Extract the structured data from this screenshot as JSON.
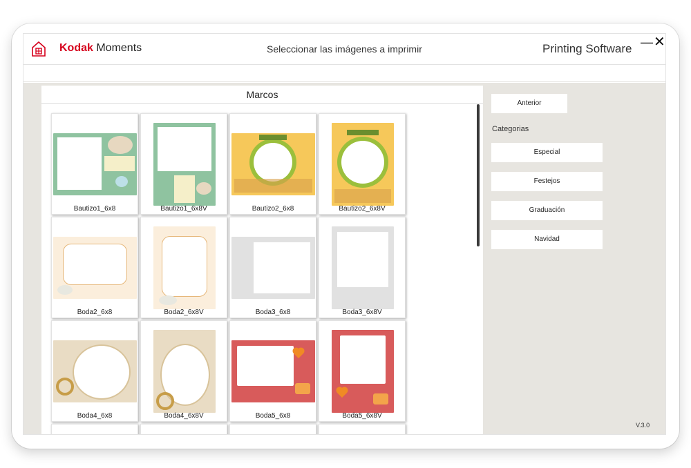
{
  "window": {
    "brand_kodak": "Kodak",
    "brand_moments": " Moments",
    "subtitle": "Seleccionar las imágenes a imprimir",
    "app_name": "Printing Software",
    "minimize": "—",
    "close": "✕"
  },
  "panel": {
    "title": "Marcos",
    "tiles": [
      {
        "label": "Bautizo1_6x8"
      },
      {
        "label": "Bautizo1_6x8V"
      },
      {
        "label": "Bautizo2_6x8"
      },
      {
        "label": "Bautizo2_6x8V"
      },
      {
        "label": "Boda2_6x8"
      },
      {
        "label": "Boda2_6x8V"
      },
      {
        "label": "Boda3_6x8"
      },
      {
        "label": "Boda3_6x8V"
      },
      {
        "label": "Boda4_6x8"
      },
      {
        "label": "Boda4_6x8V"
      },
      {
        "label": "Boda5_6x8"
      },
      {
        "label": "Boda5_6x8V"
      }
    ]
  },
  "sidebar": {
    "back_label": "Anterior",
    "categories_label": "Categorias",
    "categories": [
      "Especial",
      "Festejos",
      "Graduación",
      "Navidad"
    ]
  },
  "footer": {
    "version": "V.3.0"
  },
  "icons": {
    "home": "home-icon",
    "minimize": "minimize-icon",
    "close": "close-icon"
  },
  "colors": {
    "brand_red": "#d6001c",
    "background": "#e7e5e0"
  }
}
